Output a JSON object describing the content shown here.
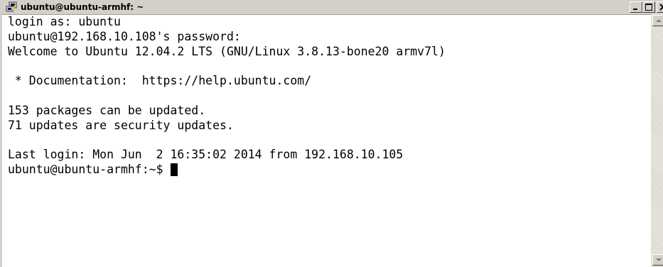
{
  "window": {
    "title": "ubuntu@ubuntu-armhf: ~",
    "icon": "putty-icon"
  },
  "terminal": {
    "lines": [
      "login as: ubuntu",
      "ubuntu@192.168.10.108's password:",
      "Welcome to Ubuntu 12.04.2 LTS (GNU/Linux 3.8.13-bone20 armv7l)",
      "",
      " * Documentation:  https://help.ubuntu.com/",
      "",
      "153 packages can be updated.",
      "71 updates are security updates.",
      "",
      "Last login: Mon Jun  2 16:35:02 2014 from 192.168.10.105"
    ],
    "prompt": "ubuntu@ubuntu-armhf:~$ "
  },
  "colors": {
    "background": "#ffffff",
    "foreground": "#000000",
    "chrome": "#d4d0c8"
  }
}
